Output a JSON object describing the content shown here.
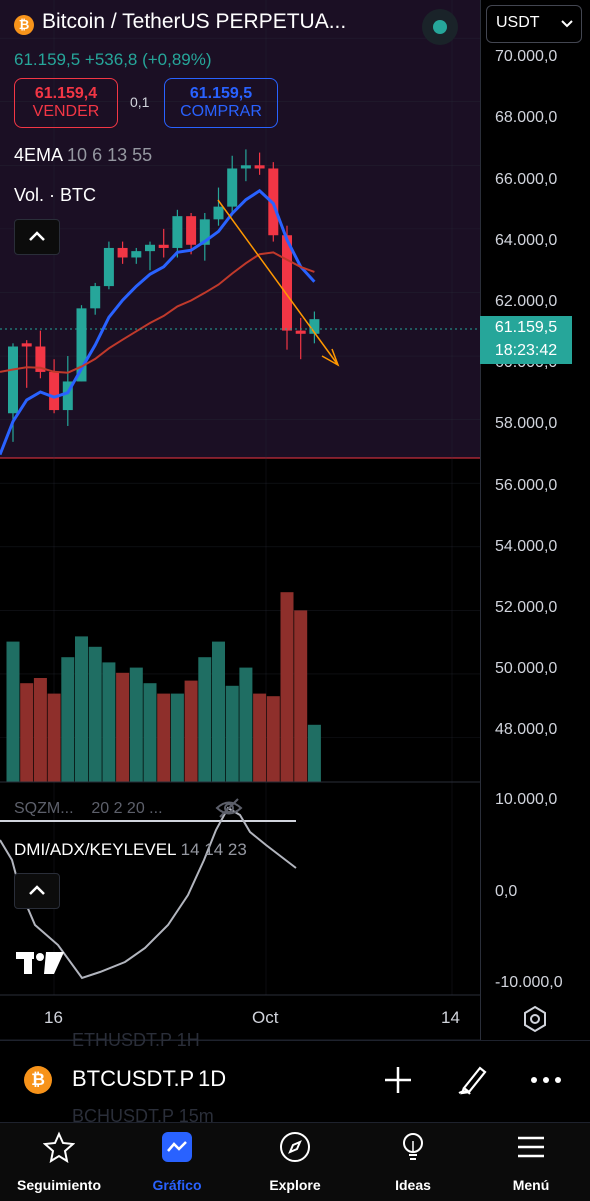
{
  "header": {
    "title": "Bitcoin / TetherUS PERPETUA...",
    "price_line": "61.159,5  +536,8 (+0,89%)"
  },
  "trade": {
    "sell_price": "61.159,4",
    "sell_label": "VENDER",
    "spread": "0,1",
    "buy_price": "61.159,5",
    "buy_label": "COMPRAR"
  },
  "indicators": {
    "ema_name": "4EMA",
    "ema_params": "10 6 13 55",
    "volume": "Vol. · BTC",
    "sqzm_name": "SQZM...",
    "sqzm_params": "20 2 20 ...",
    "dmi_name": "DMI/ADX/KEYLEVEL",
    "dmi_params": "14 14 23"
  },
  "price_axis": {
    "currency": "USDT",
    "labels": [
      "70.000,0",
      "68.000,0",
      "66.000,0",
      "64.000,0",
      "62.000,0",
      "60.000,0",
      "58.000,0",
      "56.000,0",
      "54.000,0",
      "52.000,0",
      "50.000,0",
      "48.000,0"
    ],
    "current_price": "61.159,5",
    "countdown": "18:23:42"
  },
  "indicator_axis": {
    "labels": [
      "10.000,0",
      "0,0",
      "-10.000,0"
    ]
  },
  "time_axis": {
    "labels": [
      "16",
      "Oct",
      "14"
    ]
  },
  "symbol_bar": {
    "symbol": "BTCUSDT.P",
    "interval": "1D",
    "ghost_above": "ETHUSDT.P  1H",
    "ghost_below": "BCHUSDT.P  15m"
  },
  "nav": [
    {
      "label": "Seguimiento",
      "icon": "star-icon"
    },
    {
      "label": "Gráfico",
      "icon": "chart-icon"
    },
    {
      "label": "Explore",
      "icon": "compass-icon"
    },
    {
      "label": "Ideas",
      "icon": "lightbulb-icon"
    },
    {
      "label": "Menú",
      "icon": "menu-icon"
    }
  ],
  "colors": {
    "up": "#26a69a",
    "down": "#f23645",
    "accent": "#2962ff",
    "panel_bg": "#1b0f24",
    "ema_fast": "#2962ff",
    "ema_slow": "#c0392b",
    "trendline": "#ff9800"
  },
  "chart_data": {
    "type": "candlestick",
    "ylim": [
      46600,
      71200
    ],
    "candles": [
      {
        "o": 58200,
        "h": 60400,
        "l": 57300,
        "c": 60300
      },
      {
        "o": 60400,
        "h": 60500,
        "l": 59000,
        "c": 60300
      },
      {
        "o": 60300,
        "h": 60800,
        "l": 59300,
        "c": 59500
      },
      {
        "o": 59500,
        "h": 59900,
        "l": 58200,
        "c": 58300
      },
      {
        "o": 58300,
        "h": 60000,
        "l": 57800,
        "c": 59200
      },
      {
        "o": 59200,
        "h": 61600,
        "l": 59200,
        "c": 61500
      },
      {
        "o": 61500,
        "h": 62300,
        "l": 61300,
        "c": 62200
      },
      {
        "o": 62200,
        "h": 63600,
        "l": 62100,
        "c": 63400
      },
      {
        "o": 63400,
        "h": 63600,
        "l": 62900,
        "c": 63100
      },
      {
        "o": 63100,
        "h": 63400,
        "l": 62900,
        "c": 63300
      },
      {
        "o": 63300,
        "h": 63600,
        "l": 62700,
        "c": 63500
      },
      {
        "o": 63500,
        "h": 64000,
        "l": 63100,
        "c": 63400
      },
      {
        "o": 63400,
        "h": 64600,
        "l": 63100,
        "c": 64400
      },
      {
        "o": 64400,
        "h": 64500,
        "l": 63200,
        "c": 63500
      },
      {
        "o": 63500,
        "h": 64500,
        "l": 63000,
        "c": 64300
      },
      {
        "o": 64300,
        "h": 65300,
        "l": 64100,
        "c": 64700
      },
      {
        "o": 64700,
        "h": 66300,
        "l": 64500,
        "c": 65900
      },
      {
        "o": 65900,
        "h": 66500,
        "l": 65500,
        "c": 66000
      },
      {
        "o": 66000,
        "h": 66400,
        "l": 65700,
        "c": 65900
      },
      {
        "o": 65900,
        "h": 66100,
        "l": 63600,
        "c": 63800
      },
      {
        "o": 63800,
        "h": 64100,
        "l": 60200,
        "c": 60800
      },
      {
        "o": 60800,
        "h": 61200,
        "l": 59900,
        "c": 60700
      },
      {
        "o": 60700,
        "h": 61400,
        "l": 60400,
        "c": 61160
      }
    ],
    "volume_bars": [
      5.4,
      3.8,
      4.0,
      3.4,
      4.8,
      5.6,
      5.2,
      4.6,
      4.2,
      4.4,
      3.8,
      3.4,
      3.4,
      3.9,
      4.8,
      5.4,
      3.7,
      4.4,
      3.4,
      3.3,
      7.3,
      6.6,
      2.2
    ]
  }
}
